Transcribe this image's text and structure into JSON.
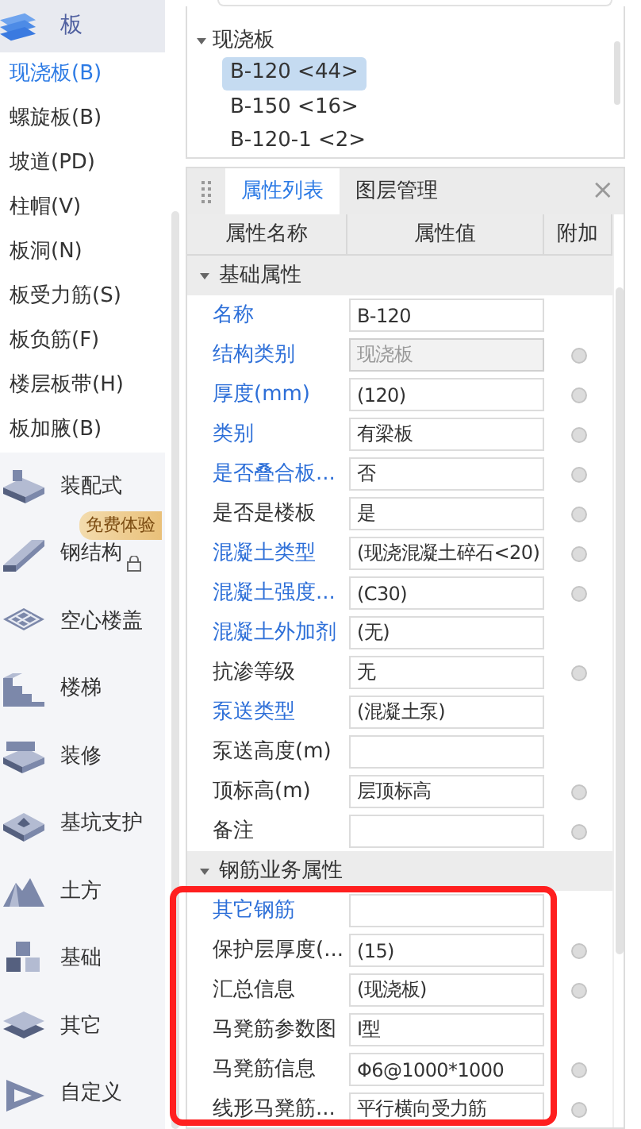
{
  "sidebar": {
    "category": {
      "label": "板"
    },
    "items": [
      {
        "label": "现浇板(B)",
        "selected": true
      },
      {
        "label": "螺旋板(B)",
        "selected": false
      },
      {
        "label": "坡道(PD)",
        "selected": false
      },
      {
        "label": "柱帽(V)",
        "selected": false
      },
      {
        "label": "板洞(N)",
        "selected": false
      },
      {
        "label": "板受力筋(S)",
        "selected": false
      },
      {
        "label": "板负筋(F)",
        "selected": false
      },
      {
        "label": "楼层板带(H)",
        "selected": false
      },
      {
        "label": "板加腋(B)",
        "selected": false
      }
    ],
    "groups": [
      {
        "label": "装配式"
      },
      {
        "label": "钢结构",
        "badge": "免费体验",
        "locked": true
      },
      {
        "label": "空心楼盖"
      },
      {
        "label": "楼梯"
      },
      {
        "label": "装修"
      },
      {
        "label": "基坑支护"
      },
      {
        "label": "土方"
      },
      {
        "label": "基础"
      },
      {
        "label": "其它"
      },
      {
        "label": "自定义"
      }
    ]
  },
  "component_tree": {
    "group": {
      "label": "现浇板",
      "expanded": true
    },
    "items": [
      {
        "label": "B-120 <44>",
        "selected": true
      },
      {
        "label": "B-150 <16>",
        "selected": false
      },
      {
        "label": "B-120-1 <2>",
        "selected": false
      }
    ]
  },
  "properties": {
    "tabs": [
      {
        "label": "属性列表",
        "selected": true
      },
      {
        "label": "图层管理",
        "selected": false
      }
    ],
    "close": "×",
    "columns": [
      "属性名称",
      "属性值",
      "附加"
    ],
    "sections": [
      {
        "title": "基础属性",
        "expanded": true,
        "rows": [
          {
            "name": "名称",
            "value": "B-120",
            "linked": true,
            "disabled": false,
            "attached": false
          },
          {
            "name": "结构类别",
            "value": "现浇板",
            "linked": true,
            "disabled": true,
            "attached": true
          },
          {
            "name": "厚度(mm)",
            "value": "(120)",
            "linked": true,
            "disabled": false,
            "attached": true
          },
          {
            "name": "类别",
            "value": "有梁板",
            "linked": true,
            "disabled": false,
            "attached": true
          },
          {
            "name": "是否叠合板...",
            "value": "否",
            "linked": true,
            "disabled": false,
            "attached": true
          },
          {
            "name": "是否是楼板",
            "value": "是",
            "linked": false,
            "disabled": false,
            "attached": true
          },
          {
            "name": "混凝土类型",
            "value": "(现浇混凝土碎石<20)",
            "linked": true,
            "disabled": false,
            "attached": true
          },
          {
            "name": "混凝土强度...",
            "value": "(C30)",
            "linked": true,
            "disabled": false,
            "attached": true
          },
          {
            "name": "混凝土外加剂",
            "value": "(无)",
            "linked": true,
            "disabled": false,
            "attached": false
          },
          {
            "name": "抗渗等级",
            "value": "无",
            "linked": false,
            "disabled": false,
            "attached": true
          },
          {
            "name": "泵送类型",
            "value": "(混凝土泵)",
            "linked": true,
            "disabled": false,
            "attached": false
          },
          {
            "name": "泵送高度(m)",
            "value": "",
            "linked": false,
            "disabled": false,
            "attached": false
          },
          {
            "name": "顶标高(m)",
            "value": "层顶标高",
            "linked": false,
            "disabled": false,
            "attached": true
          },
          {
            "name": "备注",
            "value": "",
            "linked": false,
            "disabled": false,
            "attached": true
          }
        ]
      },
      {
        "title": "钢筋业务属性",
        "expanded": true,
        "rows": [
          {
            "name": "其它钢筋",
            "value": "",
            "linked": true,
            "disabled": false,
            "attached": false
          },
          {
            "name": "保护层厚度(...",
            "value": "(15)",
            "linked": false,
            "disabled": false,
            "attached": true
          },
          {
            "name": "汇总信息",
            "value": "(现浇板)",
            "linked": false,
            "disabled": false,
            "attached": true
          },
          {
            "name": "马凳筋参数图",
            "value": "Ⅰ型",
            "linked": false,
            "disabled": false,
            "attached": false
          },
          {
            "name": "马凳筋信息",
            "value": "Φ6@1000*1000",
            "linked": false,
            "disabled": false,
            "attached": true
          },
          {
            "name": "线形马凳筋...",
            "value": "平行横向受力筋",
            "linked": false,
            "disabled": false,
            "attached": true
          }
        ]
      }
    ]
  }
}
